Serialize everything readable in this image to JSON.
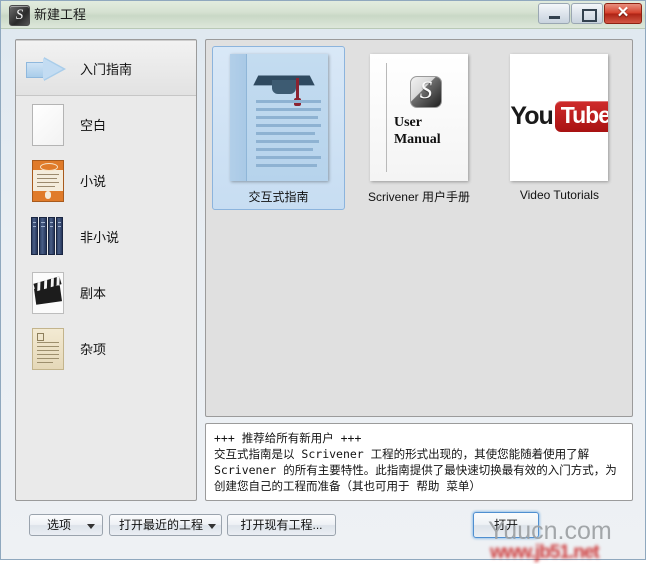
{
  "window": {
    "title": "新建工程",
    "icon": "scrivener-app-icon",
    "controls": {
      "minimize": "minimize-icon",
      "maximize": "maximize-icon",
      "close": "✕"
    }
  },
  "sidebar": {
    "items": [
      {
        "label": "入门指南",
        "icon": "blue-arrow-icon",
        "selected": true
      },
      {
        "label": "空白",
        "icon": "blank-page-icon",
        "selected": false
      },
      {
        "label": "小说",
        "icon": "novel-book-icon",
        "selected": false
      },
      {
        "label": "非小说",
        "icon": "bookshelf-icon",
        "selected": false
      },
      {
        "label": "剧本",
        "icon": "clapperboard-icon",
        "selected": false
      },
      {
        "label": "杂项",
        "icon": "parchment-icon",
        "selected": false
      }
    ]
  },
  "templates": [
    {
      "label": "交互式指南",
      "thumb": "tutorial-document-thumbnail",
      "selected": true
    },
    {
      "label": "Scrivener 用户手册",
      "thumb": "user-manual-thumbnail",
      "manual_line1": "User",
      "manual_line2": "Manual",
      "selected": false
    },
    {
      "label": "Video Tutorials",
      "thumb": "youtube-thumbnail",
      "youtube_you": "You",
      "youtube_tube": "Tube",
      "selected": false
    }
  ],
  "description": {
    "text": "+++ 推荐给所有新用户 +++\n交互式指南是以 Scrivener 工程的形式出现的，其使您能随着使用了解\nScrivener 的所有主要特性。此指南提供了最快速切换最有效的入门方式，为\n创建您自己的工程而准备（其也可用于 帮助 菜单）"
  },
  "buttons": {
    "options": "选项",
    "open_recent": "打开最近的工程",
    "open_existing": "打开现有工程...",
    "open": "打开"
  },
  "watermark": {
    "primary": "Yuucn.com",
    "secondary": "www.jb51.net"
  },
  "colors": {
    "accent": "#4f8fd0",
    "selection": "#c7ddf2",
    "youtube_red": "#cf2b2b",
    "titlebar": "#d6e2d2"
  }
}
